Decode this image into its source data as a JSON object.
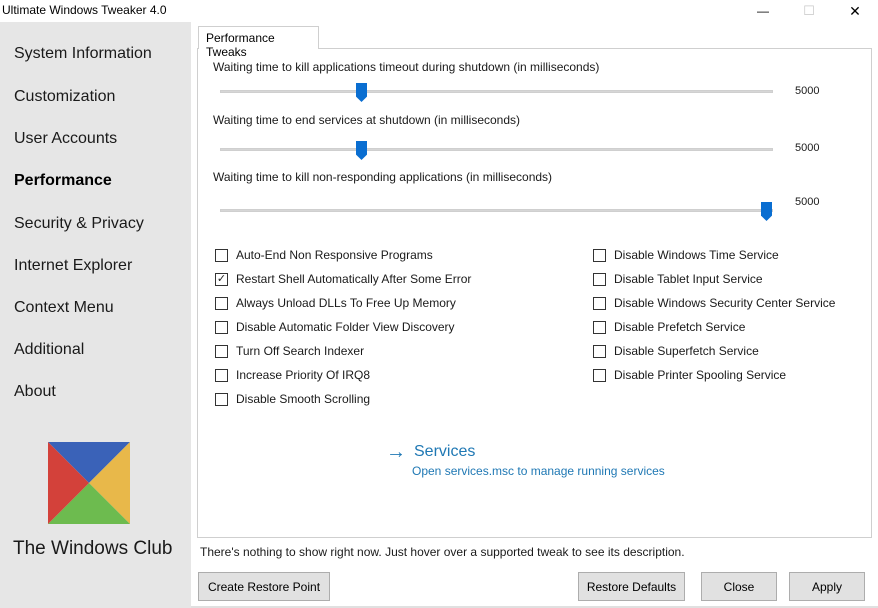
{
  "window": {
    "title": "Ultimate Windows Tweaker 4.0",
    "minimize_glyph": "—",
    "maximize_glyph": "☐",
    "close_glyph": "✕"
  },
  "sidebar": {
    "items": [
      {
        "label": "System Information"
      },
      {
        "label": "Customization"
      },
      {
        "label": "User Accounts"
      },
      {
        "label": "Performance",
        "active": true
      },
      {
        "label": "Security & Privacy"
      },
      {
        "label": "Internet Explorer"
      },
      {
        "label": "Context Menu"
      },
      {
        "label": "Additional"
      },
      {
        "label": "About"
      }
    ],
    "brand": "The Windows Club",
    "logo_colors": {
      "top": "#3a62b8",
      "right": "#e8b84a",
      "bottom": "#6dbb4f",
      "left": "#d3413a"
    }
  },
  "tab": {
    "label": "Performance Tweaks"
  },
  "sliders": [
    {
      "label": "Waiting time to kill applications timeout during shutdown (in milliseconds)",
      "value": "5000",
      "position": 0.25
    },
    {
      "label": "Waiting time to end services at shutdown (in milliseconds)",
      "value": "5000",
      "position": 0.25
    },
    {
      "label": "Waiting time to kill non-responding applications (in milliseconds)",
      "value": "5000",
      "position": 1.0
    }
  ],
  "checkboxes_left": [
    {
      "label": "Auto-End Non Responsive Programs",
      "checked": false
    },
    {
      "label": "Restart Shell Automatically After Some Error",
      "checked": true
    },
    {
      "label": "Always Unload DLLs To Free Up Memory",
      "checked": false
    },
    {
      "label": "Disable Automatic Folder View Discovery",
      "checked": false
    },
    {
      "label": "Turn Off Search Indexer",
      "checked": false
    },
    {
      "label": "Increase Priority Of IRQ8",
      "checked": false
    },
    {
      "label": "Disable Smooth Scrolling",
      "checked": false
    }
  ],
  "checkboxes_right": [
    {
      "label": "Disable Windows Time Service",
      "checked": false
    },
    {
      "label": "Disable Tablet Input Service",
      "checked": false
    },
    {
      "label": "Disable Windows Security Center Service",
      "checked": false
    },
    {
      "label": "Disable Prefetch Service",
      "checked": false
    },
    {
      "label": "Disable Superfetch Service",
      "checked": false
    },
    {
      "label": "Disable Printer Spooling Service",
      "checked": false
    }
  ],
  "services": {
    "arrow": "→",
    "title": "Services",
    "subtitle": "Open services.msc to manage running services"
  },
  "status": "There's nothing to show right now. Just hover over a supported tweak to see its description.",
  "buttons": {
    "create_restore_point": "Create Restore Point",
    "restore_defaults": "Restore Defaults",
    "close": "Close",
    "apply": "Apply"
  },
  "colors": {
    "accent": "#0a6ed1",
    "link": "#1f78b4"
  }
}
